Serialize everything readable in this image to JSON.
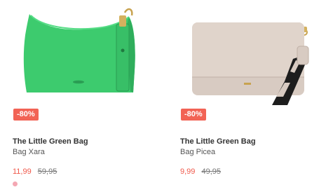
{
  "products": [
    {
      "badge": "-80%",
      "title": "The Little Green Bag",
      "subtitle": "Bag Xara",
      "price_sale": "11,99",
      "price_old": "59,95",
      "colors": {
        "bag": "#3dcb6e",
        "swatch": "#f4a7b3",
        "sale": "#f0584a",
        "badge_bg": "#f26355"
      }
    },
    {
      "badge": "-80%",
      "title": "The Little Green Bag",
      "subtitle": "Bag Picea",
      "price_sale": "9,99",
      "price_old": "49,95",
      "colors": {
        "bag": "#d8cbc2",
        "strap": "#1d1d1d",
        "sale": "#f0584a",
        "badge_bg": "#f26355"
      }
    }
  ]
}
